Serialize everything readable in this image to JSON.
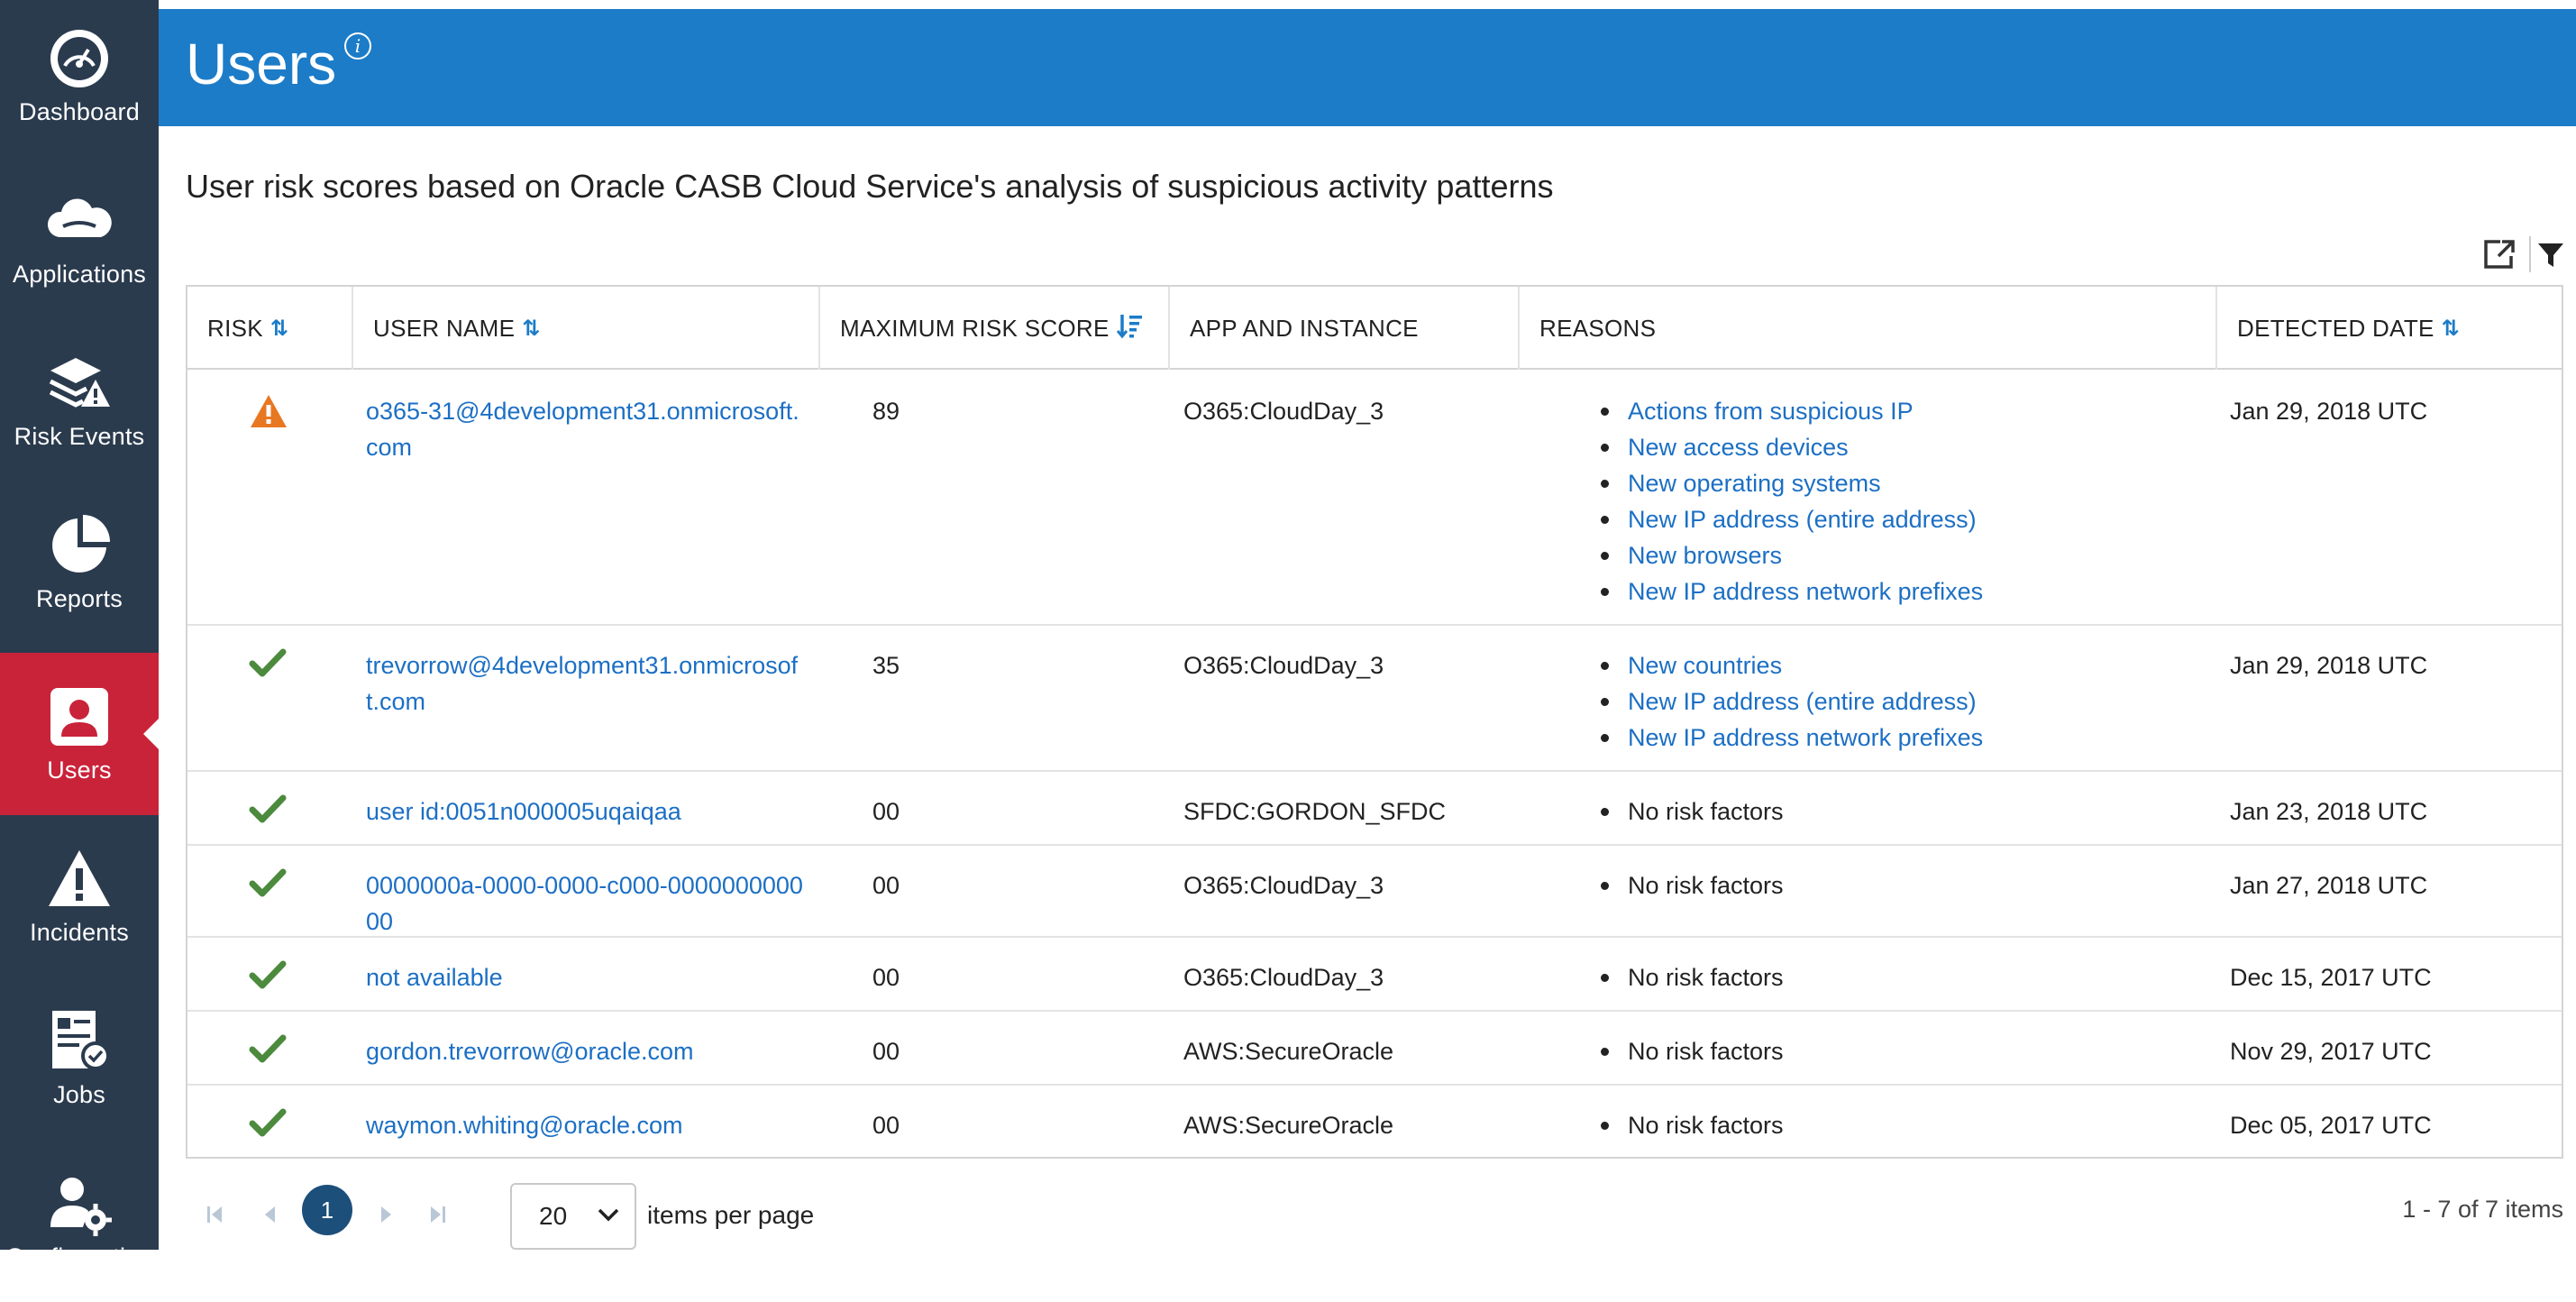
{
  "nav": {
    "items": [
      {
        "label": "Dashboard",
        "icon": "dashboard-gauge-icon"
      },
      {
        "label": "Applications",
        "icon": "cloud-icon"
      },
      {
        "label": "Risk Events",
        "icon": "layers-warning-icon"
      },
      {
        "label": "Reports",
        "icon": "pie-chart-icon"
      },
      {
        "label": "Users",
        "icon": "user-badge-icon"
      },
      {
        "label": "Incidents",
        "icon": "warning-triangle-icon"
      },
      {
        "label": "Jobs",
        "icon": "jobs-document-check-icon"
      },
      {
        "label": "Configuration",
        "icon": "user-gear-icon"
      }
    ],
    "active": "Users"
  },
  "header": {
    "title": "Users",
    "info_symbol": "i"
  },
  "subtitle": "User risk scores based on Oracle CASB Cloud Service's analysis of suspicious activity patterns",
  "table": {
    "columns": [
      {
        "label": "RISK"
      },
      {
        "label": "USER NAME"
      },
      {
        "label": "MAXIMUM RISK SCORE"
      },
      {
        "label": "APP AND INSTANCE"
      },
      {
        "label": "REASONS"
      },
      {
        "label": "DETECTED DATE"
      }
    ],
    "rows": [
      {
        "risk": "warning",
        "user": "o365-31@4development31.onmicrosoft.com",
        "score": "89",
        "app": "O365:CloudDay_3",
        "reasons": [
          "Actions from suspicious IP",
          "New access devices",
          "New operating systems",
          "New IP address (entire address)",
          "New browsers",
          "New IP address network prefixes"
        ],
        "reasons_link": true,
        "date": "Jan 29, 2018 UTC"
      },
      {
        "risk": "ok",
        "user": "trevorrow@4development31.onmicrosoft.com",
        "score": "35",
        "app": "O365:CloudDay_3",
        "reasons": [
          "New countries",
          "New IP address (entire address)",
          "New IP address network prefixes"
        ],
        "reasons_link": true,
        "date": "Jan 29, 2018 UTC"
      },
      {
        "risk": "ok",
        "user": "user id:0051n000005uqaiqaa",
        "score": "00",
        "app": "SFDC:GORDON_SFDC",
        "reasons": [
          "No risk factors"
        ],
        "reasons_link": false,
        "date": "Jan 23, 2018 UTC"
      },
      {
        "risk": "ok",
        "user": "0000000a-0000-0000-c000-000000000000",
        "score": "00",
        "app": "O365:CloudDay_3",
        "reasons": [
          "No risk factors"
        ],
        "reasons_link": false,
        "date": "Jan 27, 2018 UTC"
      },
      {
        "risk": "ok",
        "user": "not available",
        "score": "00",
        "app": "O365:CloudDay_3",
        "reasons": [
          "No risk factors"
        ],
        "reasons_link": false,
        "date": "Dec 15, 2017 UTC"
      },
      {
        "risk": "ok",
        "user": "gordon.trevorrow@oracle.com",
        "score": "00",
        "app": "AWS:SecureOracle",
        "reasons": [
          "No risk factors"
        ],
        "reasons_link": false,
        "date": "Nov 29, 2017 UTC"
      },
      {
        "risk": "ok",
        "user": "waymon.whiting@oracle.com",
        "score": "00",
        "app": "AWS:SecureOracle",
        "reasons": [
          "No risk factors"
        ],
        "reasons_link": false,
        "date": "Dec 05, 2017 UTC"
      }
    ]
  },
  "pager": {
    "current_page": "1",
    "per_page": "20",
    "per_page_label": "items per page",
    "count_text": "1 - 7 of 7 items"
  },
  "colors": {
    "header_blue": "#1c7cc8",
    "sidebar": "#2b3b4e",
    "active_nav": "#c9233a",
    "warning": "#e87722",
    "ok": "#4c8a3e",
    "link": "#1c6fc4"
  }
}
